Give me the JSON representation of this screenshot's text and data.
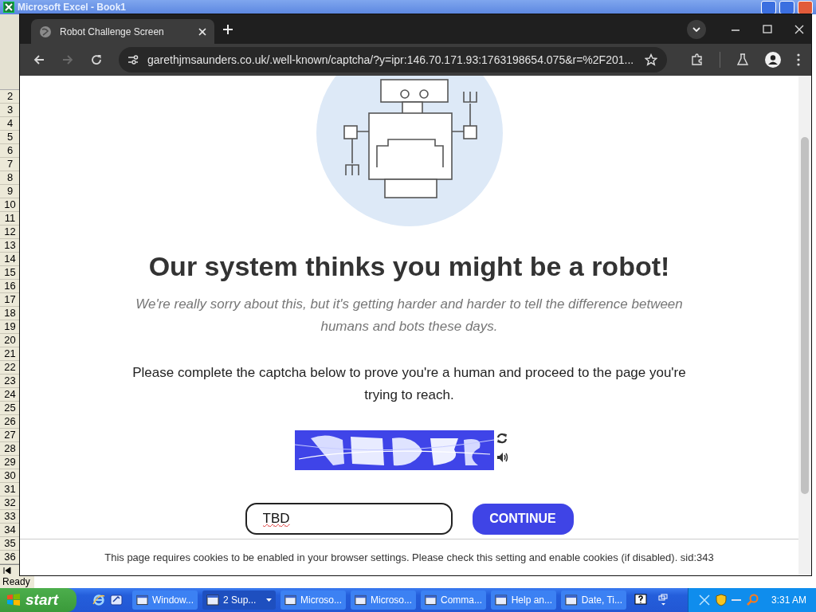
{
  "excel": {
    "title": "Microsoft Excel - Book1",
    "row_headers": [
      "2",
      "3",
      "4",
      "5",
      "6",
      "7",
      "8",
      "9",
      "10",
      "11",
      "12",
      "13",
      "14",
      "15",
      "16",
      "17",
      "18",
      "19",
      "20",
      "21",
      "22",
      "23",
      "24",
      "25",
      "26",
      "27",
      "28",
      "29",
      "30",
      "31",
      "32",
      "33",
      "34",
      "35",
      "36"
    ],
    "status": "Ready"
  },
  "browser": {
    "tabs": [
      {
        "title": "Robot Challenge Screen",
        "selected": true
      }
    ],
    "forward_disabled": true,
    "url": "garethjmsaunders.co.uk/.well-known/captcha/?y=ipr:146.70.171.93:1763198654.075&r=%2F201...",
    "page": {
      "heading": "Our system thinks you might be a robot!",
      "apology": "We're really sorry about this, but it's getting harder and harder to tell the difference between humans and bots these days.",
      "instruction": "Please complete the captcha below to prove you're a human and proceed to the page you're trying to reach.",
      "answer_field": {
        "value": "TBD",
        "misspelled": true
      },
      "continue_button": "CONTINUE",
      "cookie_notice": "This page requires cookies to be enabled in your browser settings. Please check this setting and enable cookies (if disabled). sid:343"
    }
  },
  "taskbar": {
    "start": "start",
    "tasks": [
      {
        "label": "Window...",
        "selected": false,
        "grouped": false
      },
      {
        "label": "2 Sup...",
        "selected": true,
        "grouped": true
      },
      {
        "label": "Microso...",
        "selected": false,
        "grouped": false
      },
      {
        "label": "Microso...",
        "selected": false,
        "grouped": false
      },
      {
        "label": "Comma...",
        "selected": false,
        "grouped": false
      },
      {
        "label": "Help an...",
        "selected": false,
        "grouped": false
      },
      {
        "label": "Date, Ti...",
        "selected": false,
        "grouped": false
      }
    ],
    "clock": "3:31 AM"
  }
}
